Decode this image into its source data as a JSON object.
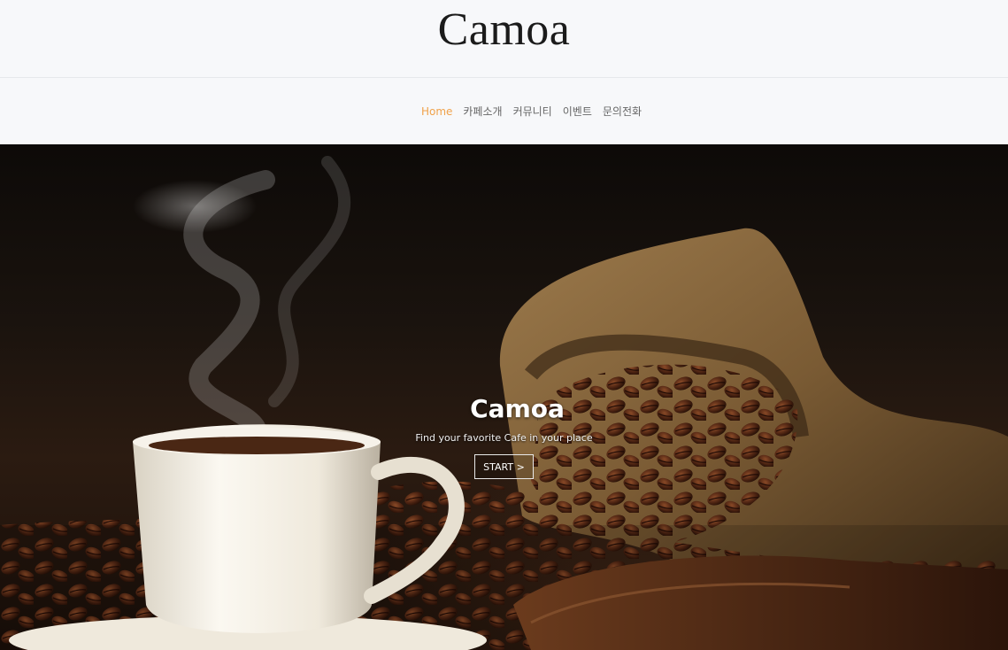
{
  "brand": {
    "logo": "Camoa"
  },
  "nav": {
    "items": [
      {
        "label": "Home",
        "active": true
      },
      {
        "label": "카페소개",
        "active": false
      },
      {
        "label": "커뮤니티",
        "active": false
      },
      {
        "label": "이벤트",
        "active": false
      },
      {
        "label": "문의전화",
        "active": false
      }
    ],
    "active_color": "#f0a24a"
  },
  "hero": {
    "title": "Camoa",
    "subtitle": "Find your favorite Cafe in your place",
    "button_label": "START >",
    "image_description_icon": "coffee-cup-and-beans"
  }
}
